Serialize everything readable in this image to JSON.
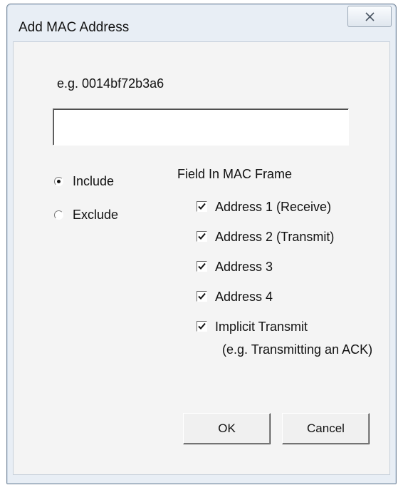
{
  "window": {
    "title": "Add MAC Address",
    "close_icon": "close-x-icon"
  },
  "form": {
    "example_text": "e.g.  0014bf72b3a6",
    "mac_input_value": ""
  },
  "mode_radios": [
    {
      "label": "Include",
      "checked": true
    },
    {
      "label": "Exclude",
      "checked": false
    }
  ],
  "field_group": {
    "label": "Field In MAC Frame",
    "options": [
      {
        "label": "Address 1 (Receive)",
        "checked": true
      },
      {
        "label": "Address 2 (Transmit)",
        "checked": true
      },
      {
        "label": "Address 3",
        "checked": true
      },
      {
        "label": "Address 4",
        "checked": true
      },
      {
        "label": "Implicit Transmit",
        "sublabel": "(e.g. Transmitting an ACK)",
        "checked": true
      }
    ]
  },
  "buttons": {
    "ok_label": "OK",
    "cancel_label": "Cancel"
  }
}
